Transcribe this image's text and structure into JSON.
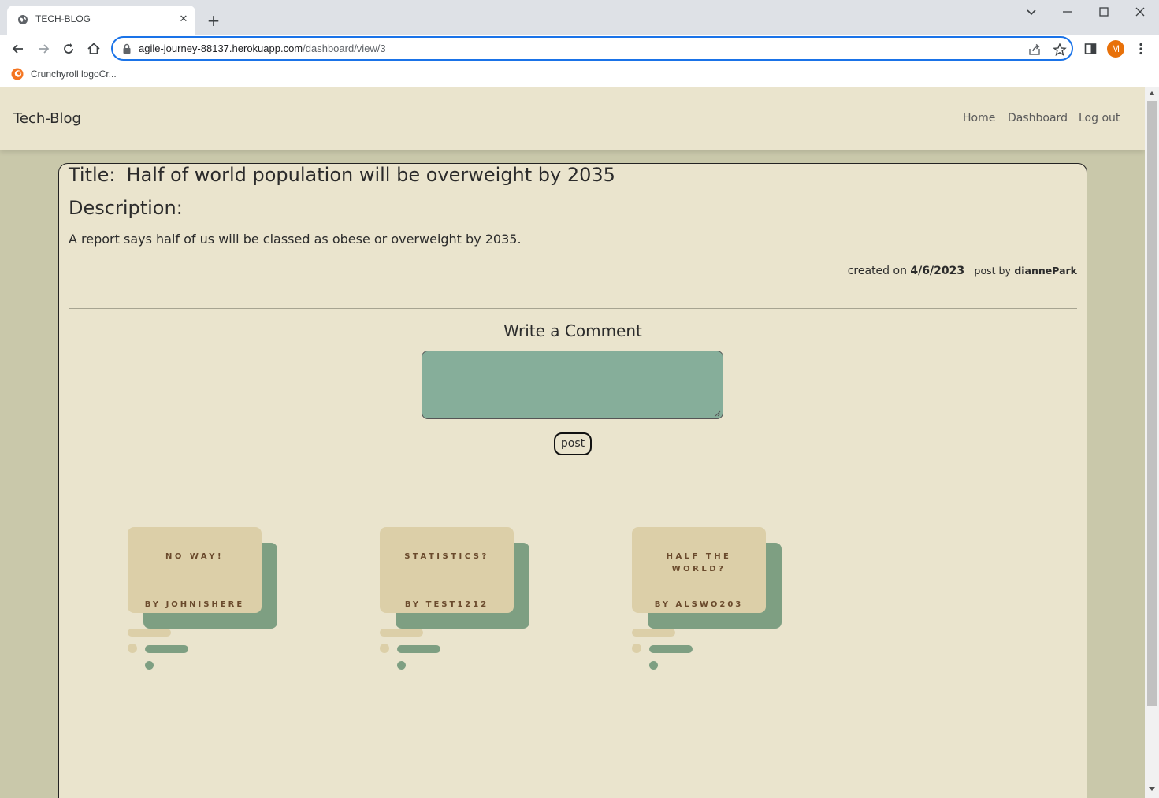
{
  "browser": {
    "tab_title": "TECH-BLOG",
    "url_domain": "agile-journey-88137.herokuapp.com",
    "url_path": "/dashboard/view/3",
    "profile_initial": "M",
    "bookmark_label": "Crunchyroll logoCr..."
  },
  "site": {
    "brand": "Tech-Blog",
    "nav": [
      "Home",
      "Dashboard",
      "Log out"
    ]
  },
  "post": {
    "title_label": "Title:",
    "title": "Half of world population will be overweight by 2035",
    "description_label": "Description:",
    "description": "A report says half of us will be classed as obese or overweight by 2035.",
    "created_label": "created on",
    "created_date": "4/6/2023",
    "post_by_label": "post by",
    "author": "diannePark"
  },
  "comment_form": {
    "heading": "Write a Comment",
    "textarea_value": "",
    "submit_label": "post"
  },
  "comments": [
    {
      "text": "NO WAY!",
      "by": "BY JOHNISHERE"
    },
    {
      "text": "STATISTICS?",
      "by": "BY TEST1212"
    },
    {
      "text": "HALF THE WORLD?",
      "by": "BY ALSWO203"
    }
  ],
  "colors": {
    "page_bg": "#c9c8aa",
    "card_bg": "#eae4cd",
    "textarea_bg": "#86ae9a",
    "note_front": "#dccfa8",
    "note_back": "#7e9f82",
    "note_text": "#6a4a2c",
    "accent": "#1a73e8"
  }
}
